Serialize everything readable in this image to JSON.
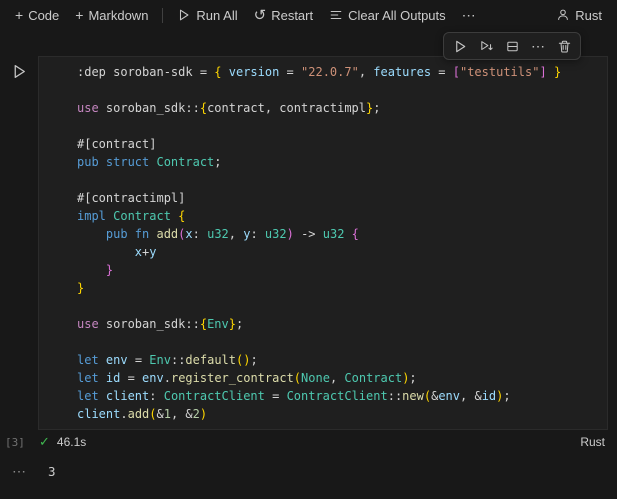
{
  "toolbar": {
    "code": "Code",
    "markdown": "Markdown",
    "run_all": "Run All",
    "restart": "Restart",
    "clear_all_outputs": "Clear All Outputs",
    "more": "⋯",
    "kernel": "Rust"
  },
  "icons": {
    "plus": "+",
    "restart": "↺",
    "more": "⋯",
    "check": "✓"
  },
  "cell": {
    "execution_count": "[3]",
    "execution_time": "46.1s",
    "language": "Rust",
    "code_lines": [
      [
        [
          "p",
          ":dep soroban-sdk = "
        ],
        [
          "b1",
          "{"
        ],
        [
          "p",
          " "
        ],
        [
          "v",
          "version"
        ],
        [
          "p",
          " = "
        ],
        [
          "s",
          "\"22.0.7\""
        ],
        [
          "p",
          ", "
        ],
        [
          "v",
          "features"
        ],
        [
          "p",
          " = "
        ],
        [
          "b2",
          "["
        ],
        [
          "s",
          "\"testutils\""
        ],
        [
          "b2",
          "]"
        ],
        [
          "p",
          " "
        ],
        [
          "b1",
          "}"
        ]
      ],
      [],
      [
        [
          "u",
          "use "
        ],
        [
          "p",
          "soroban_sdk::"
        ],
        [
          "b1",
          "{"
        ],
        [
          "p",
          "contract, contractimpl"
        ],
        [
          "b1",
          "}"
        ],
        [
          "p",
          ";"
        ]
      ],
      [],
      [
        [
          "p",
          "#[contract]"
        ]
      ],
      [
        [
          "k",
          "pub struct "
        ],
        [
          "t",
          "Contract"
        ],
        [
          "p",
          ";"
        ]
      ],
      [],
      [
        [
          "p",
          "#[contractimpl]"
        ]
      ],
      [
        [
          "k",
          "impl "
        ],
        [
          "t",
          "Contract"
        ],
        [
          "p",
          " "
        ],
        [
          "b1",
          "{"
        ]
      ],
      [
        [
          "p",
          "    "
        ],
        [
          "k",
          "pub fn "
        ],
        [
          "f",
          "add"
        ],
        [
          "b2",
          "("
        ],
        [
          "v",
          "x"
        ],
        [
          "p",
          ": "
        ],
        [
          "t",
          "u32"
        ],
        [
          "p",
          ", "
        ],
        [
          "v",
          "y"
        ],
        [
          "p",
          ": "
        ],
        [
          "t",
          "u32"
        ],
        [
          "b2",
          ")"
        ],
        [
          "p",
          " -> "
        ],
        [
          "t",
          "u32"
        ],
        [
          "p",
          " "
        ],
        [
          "b2",
          "{"
        ]
      ],
      [
        [
          "p",
          "        "
        ],
        [
          "v",
          "x"
        ],
        [
          "p",
          "+"
        ],
        [
          "v",
          "y"
        ]
      ],
      [
        [
          "p",
          "    "
        ],
        [
          "b2",
          "}"
        ]
      ],
      [
        [
          "b1",
          "}"
        ]
      ],
      [],
      [
        [
          "u",
          "use "
        ],
        [
          "p",
          "soroban_sdk::"
        ],
        [
          "b1",
          "{"
        ],
        [
          "t",
          "Env"
        ],
        [
          "b1",
          "}"
        ],
        [
          "p",
          ";"
        ]
      ],
      [],
      [
        [
          "k",
          "let "
        ],
        [
          "v",
          "env"
        ],
        [
          "p",
          " = "
        ],
        [
          "t",
          "Env"
        ],
        [
          "p",
          "::"
        ],
        [
          "f",
          "default"
        ],
        [
          "b1",
          "()"
        ],
        [
          "p",
          ";"
        ]
      ],
      [
        [
          "k",
          "let "
        ],
        [
          "v",
          "id"
        ],
        [
          "p",
          " = "
        ],
        [
          "v",
          "env"
        ],
        [
          "p",
          "."
        ],
        [
          "f",
          "register_contract"
        ],
        [
          "b1",
          "("
        ],
        [
          "t",
          "None"
        ],
        [
          "p",
          ", "
        ],
        [
          "t",
          "Contract"
        ],
        [
          "b1",
          ")"
        ],
        [
          "p",
          ";"
        ]
      ],
      [
        [
          "k",
          "let "
        ],
        [
          "v",
          "client"
        ],
        [
          "p",
          ": "
        ],
        [
          "t",
          "ContractClient"
        ],
        [
          "p",
          " = "
        ],
        [
          "t",
          "ContractClient"
        ],
        [
          "p",
          "::"
        ],
        [
          "f",
          "new"
        ],
        [
          "b1",
          "("
        ],
        [
          "p",
          "&"
        ],
        [
          "v",
          "env"
        ],
        [
          "p",
          ", &"
        ],
        [
          "v",
          "id"
        ],
        [
          "b1",
          ")"
        ],
        [
          "p",
          ";"
        ]
      ],
      [
        [
          "v",
          "client"
        ],
        [
          "p",
          "."
        ],
        [
          "f",
          "add"
        ],
        [
          "b1",
          "("
        ],
        [
          "p",
          "&"
        ],
        [
          "n",
          "1"
        ],
        [
          "p",
          ", &"
        ],
        [
          "n",
          "2"
        ],
        [
          "b1",
          ")"
        ]
      ]
    ]
  },
  "output": {
    "more": "⋯",
    "value": "3"
  }
}
